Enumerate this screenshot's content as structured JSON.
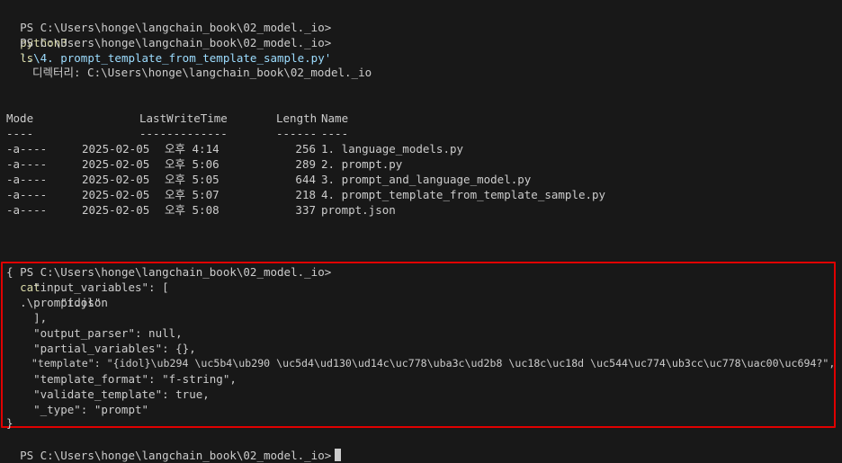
{
  "terminal": {
    "prompt": "PS C:\\Users\\honge\\langchain_book\\02_model._io>",
    "commands": {
      "run_cmd": "python3",
      "run_arg": "'.\\4. prompt_template_from_template_sample.py'",
      "ls_cmd": "ls",
      "cat_cmd": "cat",
      "cat_arg": ".\\prompt.json"
    },
    "dir_label": "디렉터리: C:\\Users\\honge\\langchain_book\\02_model._io",
    "table": {
      "headers": {
        "mode": "Mode",
        "time": "LastWriteTime",
        "length": "Length",
        "name": "Name"
      },
      "underlines": {
        "mode": "----",
        "time": "-------------",
        "length": "------",
        "name": "----"
      },
      "rows": [
        {
          "mode": "-a----",
          "date": "2025-02-05",
          "time": "오후 4:14",
          "length": "256",
          "name": "1. language_models.py"
        },
        {
          "mode": "-a----",
          "date": "2025-02-05",
          "time": "오후 5:06",
          "length": "289",
          "name": "2. prompt.py"
        },
        {
          "mode": "-a----",
          "date": "2025-02-05",
          "time": "오후 5:05",
          "length": "644",
          "name": "3. prompt_and_language_model.py"
        },
        {
          "mode": "-a----",
          "date": "2025-02-05",
          "time": "오후 5:07",
          "length": "218",
          "name": "4. prompt_template_from_template_sample.py"
        },
        {
          "mode": "-a----",
          "date": "2025-02-05",
          "time": "오후 5:08",
          "length": "337",
          "name": "prompt.json"
        }
      ]
    },
    "json_lines": [
      "{",
      "    \"input_variables\": [",
      "        \"idol\"",
      "    ],",
      "    \"output_parser\": null,",
      "    \"partial_variables\": {},",
      "    \"template\": \"{idol}\\ub294 \\uc5b4\\ub290 \\uc5d4\\ud130\\ud14c\\uc778\\uba3c\\ud2b8 \\uc18c\\uc18d \\uc544\\uc774\\ub3cc\\uc778\\uac00\\uc694?\",",
      "    \"template_format\": \"f-string\",",
      "    \"validate_template\": true,",
      "    \"_type\": \"prompt\"",
      "}"
    ]
  },
  "colors": {
    "background": "#181818",
    "text": "#cccccc",
    "command": "#dcdcaa",
    "string_arg": "#9cdcfe",
    "highlight_border": "#e00000"
  }
}
